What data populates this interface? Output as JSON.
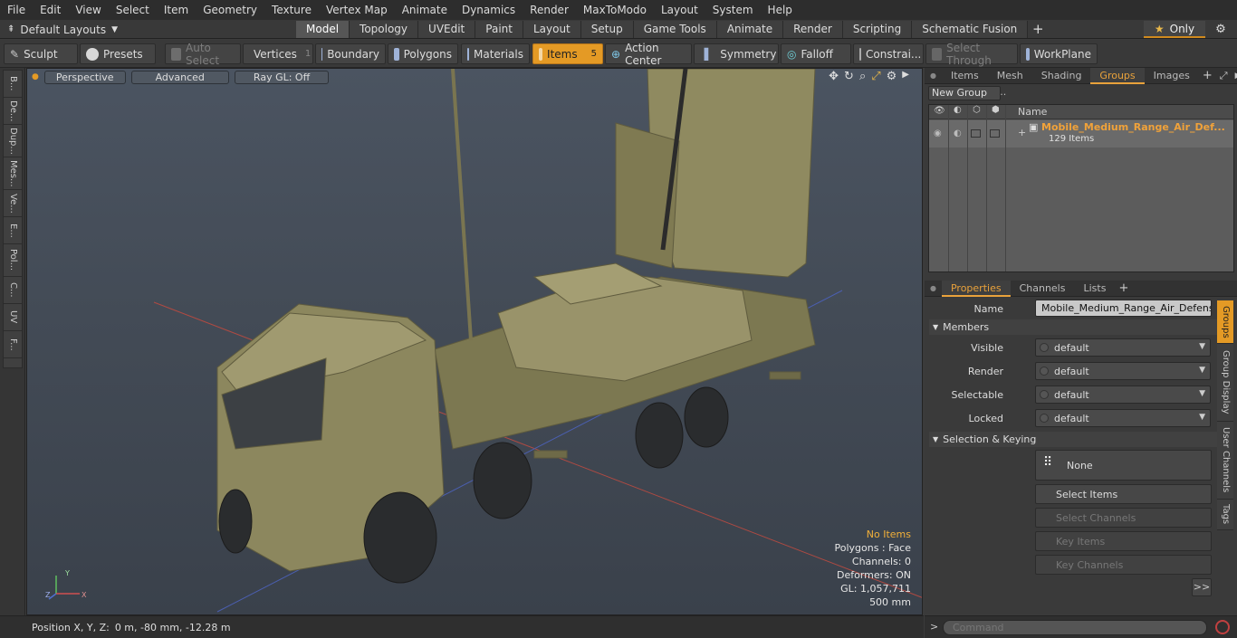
{
  "menu": [
    "File",
    "Edit",
    "View",
    "Select",
    "Item",
    "Geometry",
    "Texture",
    "Vertex Map",
    "Animate",
    "Dynamics",
    "Render",
    "MaxToModo",
    "Layout",
    "System",
    "Help"
  ],
  "layout": {
    "selector_label": "Default Layouts",
    "tabs": [
      "Model",
      "Topology",
      "UVEdit",
      "Paint",
      "Layout",
      "Setup",
      "Game Tools",
      "Animate",
      "Render",
      "Scripting",
      "Schematic Fusion"
    ],
    "active_tab": "Model",
    "only_label": "Only"
  },
  "toolbar": {
    "sculpt": "Sculpt",
    "presets": "Presets",
    "auto_select": "Auto Select",
    "vertices": "Vertices",
    "vertices_count": "1",
    "boundary": "Boundary",
    "polygons": "Polygons",
    "materials": "Materials",
    "items": "Items",
    "items_count": "5",
    "action_center": "Action Center",
    "symmetry": "Symmetry",
    "falloff": "Falloff",
    "constraints": "Constrai...",
    "select_through": "Select Through",
    "workplane": "WorkPlane"
  },
  "left_tabs": [
    "B...",
    "De...",
    "Dup...",
    "Mes...",
    "Ve...",
    "E...",
    "Pol...",
    "C...",
    "UV",
    "F..."
  ],
  "viewport": {
    "perspective": "Perspective",
    "advanced": "Advanced",
    "raygl": "Ray GL: Off",
    "stats": {
      "no_items": "No Items",
      "polygons": "Polygons : Face",
      "channels": "Channels: 0",
      "deformers": "Deformers: ON",
      "gl": "GL: 1,057,711",
      "scale": "500 mm"
    },
    "axis_x": "X",
    "axis_y": "Y",
    "axis_z": "Z"
  },
  "status": {
    "label": "Position X, Y, Z:",
    "value": "0 m, -80 mm, -12.28 m"
  },
  "groups_panel": {
    "tabs": [
      "Items",
      "Mesh ...",
      "Shading",
      "Groups",
      "Images"
    ],
    "active_tab": "Groups",
    "new_group": "New Group",
    "name_header": "Name",
    "group_name": "Mobile_Medium_Range_Air_Def...",
    "group_count": "129 Items"
  },
  "properties_panel": {
    "tabs": [
      "Properties",
      "Channels",
      "Lists"
    ],
    "active_tab": "Properties",
    "name_label": "Name",
    "name_value": "Mobile_Medium_Range_Air_Defense_I",
    "members_label": "Members",
    "rows": [
      {
        "label": "Visible",
        "value": "default"
      },
      {
        "label": "Render",
        "value": "default"
      },
      {
        "label": "Selectable",
        "value": "default"
      },
      {
        "label": "Locked",
        "value": "default"
      }
    ],
    "sel_keying_label": "Selection & Keying",
    "none_label": "None",
    "select_items": "Select Items",
    "select_channels": "Select Channels",
    "key_items": "Key Items",
    "key_channels": "Key Channels",
    "more": ">>"
  },
  "side_tabs": [
    "Groups",
    "Group Display",
    "User Channels",
    "Tags"
  ],
  "command": {
    "placeholder": "Command",
    "prompt": ">"
  },
  "colors": {
    "accent": "#e49a25",
    "group_name": "#f0a23a",
    "vehicle": "#8f8a60"
  }
}
